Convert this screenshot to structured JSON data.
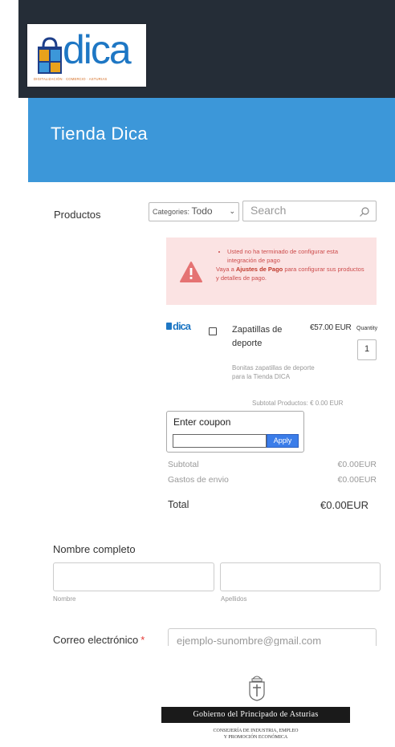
{
  "logo": {
    "wordmark": "dica",
    "tagline": "DIGITALIZACIÓN · COMERCIO · ASTURIAS",
    "brand_color": "#1e77c4"
  },
  "header": {
    "title": "Tienda Dica",
    "background": "#3c97d9"
  },
  "products": {
    "label": "Productos",
    "category_prefix": "Categories:",
    "category_value": "Todo",
    "search_placeholder": "Search"
  },
  "alert": {
    "bullet": "Usted no ha terminado de configurar esta integración de pago",
    "line_prefix": "Vaya a",
    "link": "Ajustes de Pago",
    "line_suffix": "para configurar sus productos y detalles de pago."
  },
  "product": {
    "logo": "dica",
    "name": "Zapatillas de deporte",
    "price": "€57.00 EUR",
    "quantity_label": "Quantity",
    "quantity": "1",
    "description": "Bonitas zapatillas de deporte para la Tienda DICA",
    "subtotal_label": "Subtotal Productos:",
    "subtotal_value": "€ 0.00 EUR"
  },
  "coupon": {
    "title": "Enter coupon",
    "apply_label": "Apply"
  },
  "summary": {
    "subtotal_label": "Subtotal",
    "subtotal_value": "€0.00EUR",
    "shipping_label": "Gastos de envio",
    "shipping_value": "€0.00EUR",
    "total_label": "Total",
    "total_value": "€0.00EUR"
  },
  "form": {
    "fullname_label": "Nombre completo",
    "first_name_sub": "Nombre",
    "last_name_sub": "Apellidos",
    "email_label": "Correo electrónico",
    "required_mark": "*",
    "email_placeholder": "ejemplo-sunombre@gmail.com"
  },
  "footer": {
    "band": "Gobierno del Principado de Asturias",
    "line1": "CONSEJERÍA DE INDUSTRIA, EMPLEO",
    "line2": "Y PROMOCIÓN ECONÓMICA"
  }
}
